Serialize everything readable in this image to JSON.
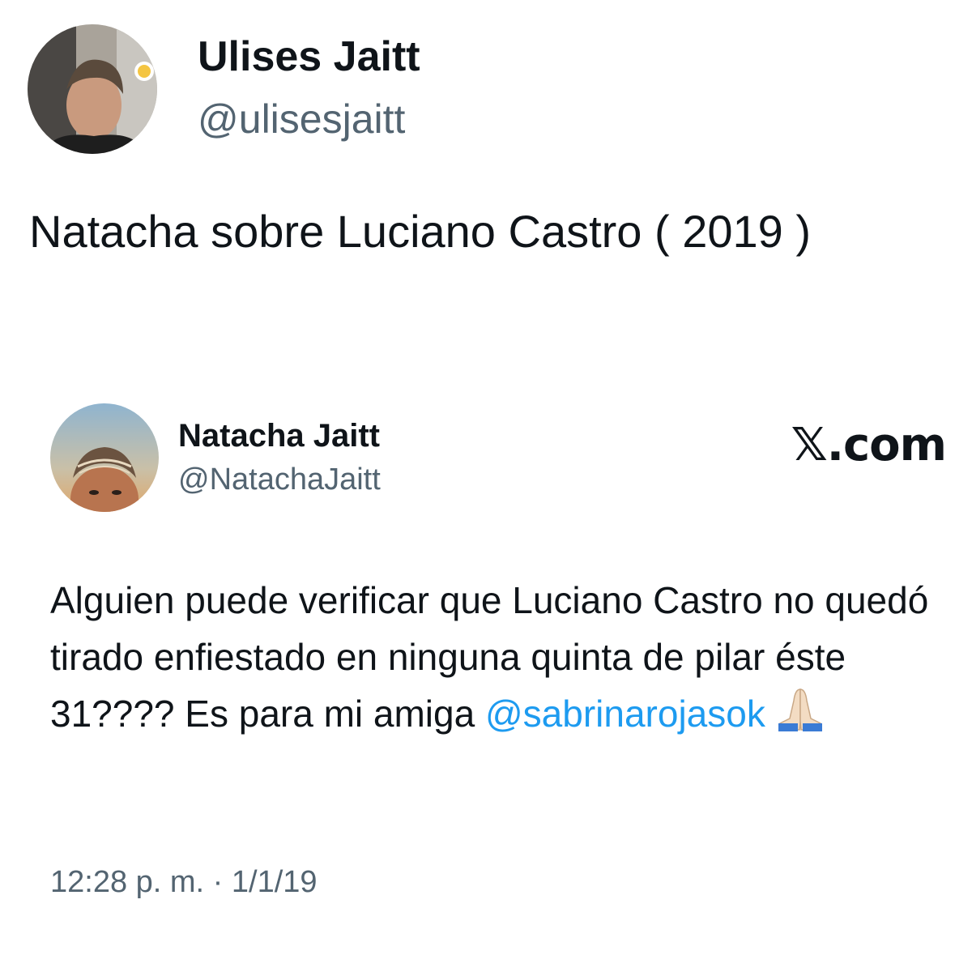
{
  "outer_tweet": {
    "author_name": "Ulises Jaitt",
    "author_handle": "@ulisesjaitt",
    "avatar": "profile-photo-man",
    "text": "Natacha sobre Luciano Castro ( 2019 )"
  },
  "quoted_tweet": {
    "author_name": "Natacha Jaitt",
    "author_handle": "@NatachaJaitt",
    "avatar": "profile-photo-woman",
    "source_label": "𝕏.com",
    "text_main": "Alguien puede verificar que Luciano Castro no quedó tirado enfiestado en ninguna quinta de pilar éste 31???? Es para mi amiga ",
    "mention": "@sabrinarojasok",
    "emoji": "folded-hands-icon",
    "timestamp": "12:28 p. m. · 1/1/19"
  },
  "colors": {
    "text_primary": "#0f1419",
    "text_secondary": "#536471",
    "mention": "#1d9bf0",
    "background": "#ffffff"
  }
}
